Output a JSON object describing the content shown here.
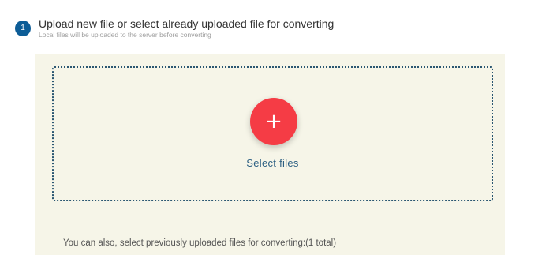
{
  "step": {
    "number": "1",
    "title": "Upload new file or select already uploaded file for converting",
    "subtitle": "Local files will be uploaded to the server before converting"
  },
  "dropzone": {
    "button_icon": "+",
    "button_icon_name": "plus-icon",
    "select_label": "Select files"
  },
  "previous_files": {
    "text": "You can also, select previously uploaded files for converting:(1 total)"
  },
  "colors": {
    "step_badge": "#0d5d97",
    "panel_background": "#f6f5e8",
    "dropzone_border": "#2a5671",
    "fab": "#f53c45",
    "link": "#2c5f82"
  }
}
